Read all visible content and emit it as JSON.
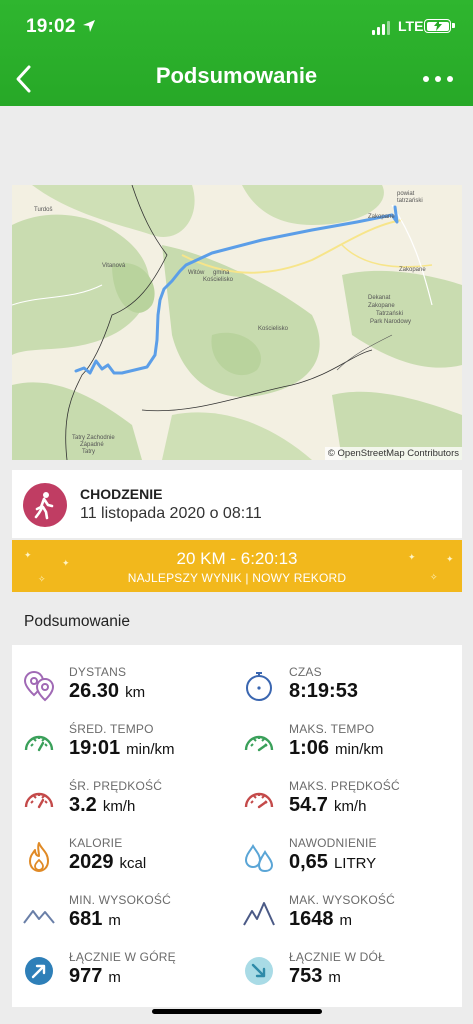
{
  "status_bar": {
    "time": "19:02",
    "network": "LTE"
  },
  "header": {
    "title": "Podsumowanie"
  },
  "map": {
    "credit": "© OpenStreetMap Contributors",
    "labels": {
      "turdos": "Turdoš",
      "vitanova": "Vitanová",
      "powiat": "powiat",
      "tatrzanski": "tatrzański",
      "zakopane_top": "Zakopane",
      "zakopane_mid": "Zakopane",
      "witow": "Witów",
      "gmina": "gmina",
      "koscielisko_a": "Kościelisko",
      "koscielisko_b": "Kościelisko",
      "dekanat": "Dekanat",
      "zakopane_dek": "Zakopane",
      "tatrzanski_park": "Tatrzański",
      "park_narodowy": "Park Narodowy",
      "tatry": "Tatry Zachodnie",
      "zapadne": "Západné",
      "tatry2": "Tatry"
    }
  },
  "activity": {
    "type": "CHODZENIE",
    "date": "11 listopada 2020 o 08:11"
  },
  "record": {
    "main": "20 KM - 6:20:13",
    "sub": "NAJLEPSZY WYNIK  |  NOWY REKORD"
  },
  "summary": {
    "title": "Podsumowanie",
    "distance": {
      "label": "DYSTANS",
      "value": "26.30",
      "unit": "km"
    },
    "time": {
      "label": "CZAS",
      "value": "8:19:53",
      "unit": ""
    },
    "avg_pace": {
      "label": "ŚRED. TEMPO",
      "value": "19:01",
      "unit": "min/km"
    },
    "max_pace": {
      "label": "MAKS. TEMPO",
      "value": "1:06",
      "unit": "min/km"
    },
    "avg_speed": {
      "label": "ŚR. PRĘDKOŚĆ",
      "value": "3.2",
      "unit": "km/h"
    },
    "max_speed": {
      "label": "MAKS. PRĘDKOŚĆ",
      "value": "54.7",
      "unit": "km/h"
    },
    "calories": {
      "label": "KALORIE",
      "value": "2029",
      "unit": "kcal"
    },
    "hydration": {
      "label": "NAWODNIENIE",
      "value": "0,65",
      "unit": "LITRY"
    },
    "min_alt": {
      "label": "MIN. WYSOKOŚĆ",
      "value": "681",
      "unit": "m"
    },
    "max_alt": {
      "label": "MAK. WYSOKOŚĆ",
      "value": "1648",
      "unit": "m"
    },
    "ascent": {
      "label": "ŁĄCZNIE W GÓRĘ",
      "value": "977",
      "unit": "m"
    },
    "descent": {
      "label": "ŁĄCZNIE W DÓŁ",
      "value": "753",
      "unit": "m"
    }
  },
  "colors": {
    "green": "#2fb62f",
    "gold": "#f2b81c",
    "route": "#5b9ee8",
    "activity": "#c03d63"
  }
}
